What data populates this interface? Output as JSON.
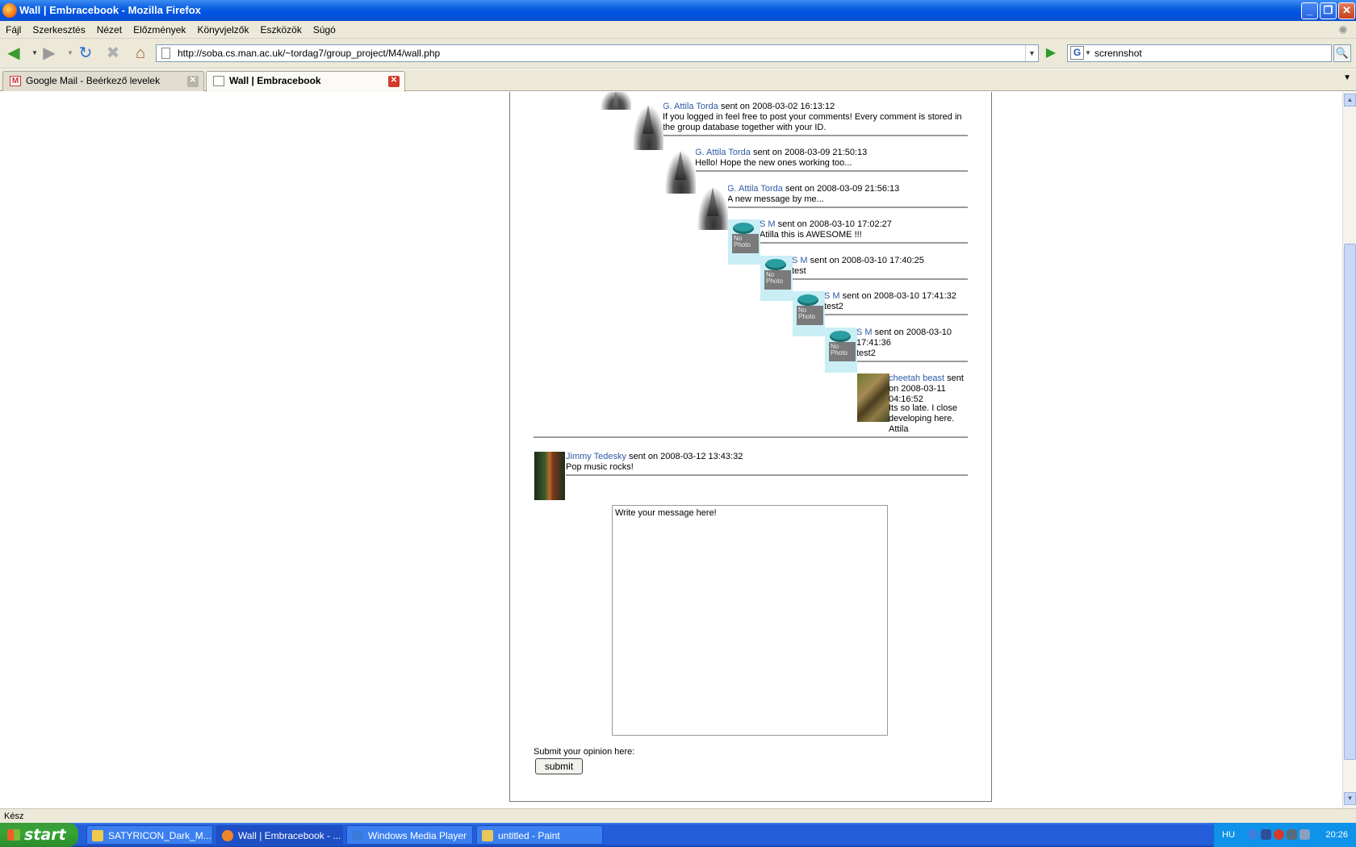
{
  "window": {
    "title": "Wall | Embracebook - Mozilla Firefox",
    "buttons": {
      "minimize": "_",
      "restore": "❐",
      "close": "✕"
    }
  },
  "menu": [
    "Fájl",
    "Szerkesztés",
    "Nézet",
    "Előzmények",
    "Könyvjelzők",
    "Eszközök",
    "Súgó"
  ],
  "toolbar": {
    "url": "http://soba.cs.man.ac.uk/~tordag7/group_project/M4/wall.php",
    "search_value": "scrennshot",
    "search_engine": "G"
  },
  "tabs": [
    {
      "label": "Google Mail - Beérkező levelek",
      "icon": "gmail-icon",
      "active": false
    },
    {
      "label": "Wall | Embracebook",
      "icon": "page-icon",
      "active": true
    }
  ],
  "wall": {
    "messages": [
      {
        "author": "G. Attila Torda",
        "meta": " sent on 2008-03-02 16:13:12",
        "text": "If you logged in feel free to post your comments! Every comment is stored in the group database together with your ID.",
        "avatar": "tree"
      },
      {
        "author": "G. Attila Torda",
        "meta": " sent on 2008-03-09 21:50:13",
        "text": "Hello! Hope the new ones working too...",
        "avatar": "tree"
      },
      {
        "author": "G. Attila Torda",
        "meta": " sent on 2008-03-09 21:56:13",
        "text": "A new message by me...",
        "avatar": "tree"
      },
      {
        "author": "S M",
        "meta": " sent on 2008-03-10 17:02:27",
        "text": "Atilla this is AWESOME !!!",
        "avatar": "nophoto"
      },
      {
        "author": "S M",
        "meta": " sent on 2008-03-10 17:40:25",
        "text": "test",
        "avatar": "nophoto"
      },
      {
        "author": "S M",
        "meta": " sent on 2008-03-10 17:41:32",
        "text": "test2",
        "avatar": "nophoto"
      },
      {
        "author": "S M",
        "meta": " sent on 2008-03-10 17:41:36",
        "text": "test2",
        "avatar": "nophoto"
      },
      {
        "author": "cheetah beast",
        "meta": " sent on 2008-03-11 04:16:52",
        "text": "Its so late. I close developing here. Attila",
        "avatar": "cheetah"
      },
      {
        "author": "Jimmy Tedesky",
        "meta": " sent on 2008-03-12 13:43:32",
        "text": "Pop music rocks!",
        "avatar": "jimmy"
      }
    ],
    "nophoto_text": "No Photo",
    "textarea_value": "Write your message here!",
    "submit_label": "Submit your opinion here:",
    "submit_button": "submit"
  },
  "status": "Kész",
  "taskbar": {
    "start": "start",
    "tasks": [
      {
        "label": "SATYRICON_Dark_M...",
        "icon": "folder-icon",
        "color": "#f1c94a"
      },
      {
        "label": "Wall | Embracebook - ...",
        "icon": "firefox-icon",
        "color": "#f0862a"
      },
      {
        "label": "Windows Media Player",
        "icon": "media-player-icon",
        "color": "#3a7ad9"
      },
      {
        "label": "untitled - Paint",
        "icon": "paint-icon",
        "color": "#e8c85a"
      }
    ],
    "lang": "HU",
    "clock": "20:26"
  }
}
